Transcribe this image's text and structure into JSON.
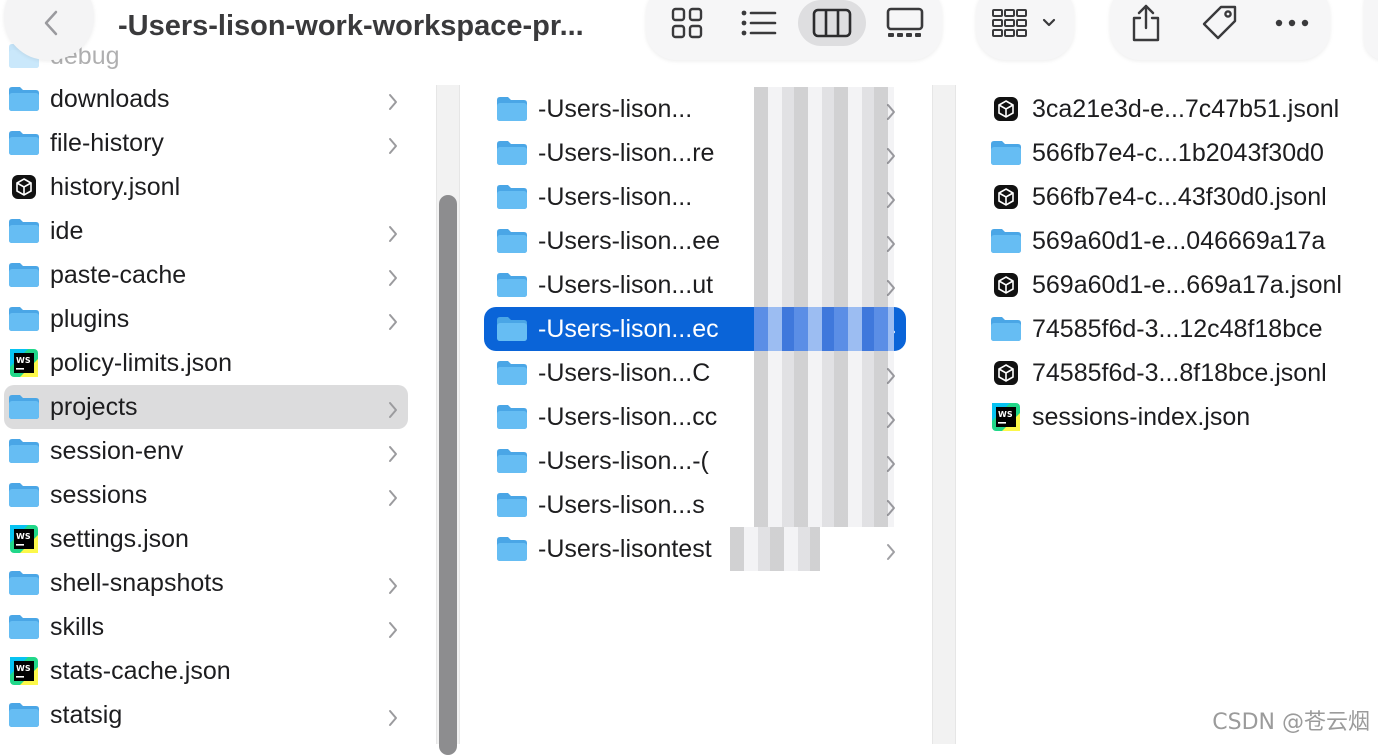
{
  "toolbar": {
    "title": "-Users-lison-work-workspace-pr...",
    "icons": [
      "back-chevron-icon",
      "grid-view-icon",
      "list-view-icon",
      "column-view-icon",
      "gallery-view-icon",
      "group-icon",
      "share-icon",
      "tag-icon",
      "more-icon"
    ]
  },
  "sidebar": {
    "partial_top": "debug",
    "items": [
      {
        "label": "downloads",
        "kind": "folder",
        "chevron": true
      },
      {
        "label": "file-history",
        "kind": "folder",
        "chevron": true
      },
      {
        "label": "history.jsonl",
        "kind": "jsonl",
        "chevron": false
      },
      {
        "label": "ide",
        "kind": "folder",
        "chevron": true
      },
      {
        "label": "paste-cache",
        "kind": "folder",
        "chevron": true
      },
      {
        "label": "plugins",
        "kind": "folder",
        "chevron": true
      },
      {
        "label": "policy-limits.json",
        "kind": "ws",
        "chevron": false
      },
      {
        "label": "projects",
        "kind": "folder",
        "chevron": true,
        "selected": true
      },
      {
        "label": "session-env",
        "kind": "folder",
        "chevron": true
      },
      {
        "label": "sessions",
        "kind": "folder",
        "chevron": true
      },
      {
        "label": "settings.json",
        "kind": "ws",
        "chevron": false
      },
      {
        "label": "shell-snapshots",
        "kind": "folder",
        "chevron": true
      },
      {
        "label": "skills",
        "kind": "folder",
        "chevron": true
      },
      {
        "label": "stats-cache.json",
        "kind": "ws",
        "chevron": false
      },
      {
        "label": "statsig",
        "kind": "folder",
        "chevron": true
      }
    ]
  },
  "projects": {
    "items": [
      {
        "label": "-Users-lison...",
        "suffix": ""
      },
      {
        "label": "-Users-lison...",
        "suffix": "re"
      },
      {
        "label": "-Users-lison...",
        "suffix": ""
      },
      {
        "label": "-Users-lison...",
        "suffix": "ee"
      },
      {
        "label": "-Users-lison...",
        "suffix": "ut"
      },
      {
        "label": "-Users-lison...",
        "suffix": "ec",
        "selected": true
      },
      {
        "label": "-Users-lison...",
        "suffix": "C"
      },
      {
        "label": "-Users-lison...",
        "suffix": "cc"
      },
      {
        "label": "-Users-lison...",
        "suffix": "-("
      },
      {
        "label": "-Users-lison...",
        "suffix": "s"
      },
      {
        "label": "-Users-lison",
        "suffix": "test"
      }
    ]
  },
  "files": {
    "items": [
      {
        "label": "3ca21e3d-e...7c47b51.jsonl",
        "kind": "jsonl"
      },
      {
        "label": "566fb7e4-c...1b2043f30d0",
        "kind": "folder"
      },
      {
        "label": "566fb7e4-c...43f30d0.jsonl",
        "kind": "jsonl"
      },
      {
        "label": "569a60d1-e...046669a17a",
        "kind": "folder"
      },
      {
        "label": "569a60d1-e...669a17a.jsonl",
        "kind": "jsonl"
      },
      {
        "label": "74585f6d-3...12c48f18bce",
        "kind": "folder"
      },
      {
        "label": "74585f6d-3...8f18bce.jsonl",
        "kind": "jsonl"
      },
      {
        "label": "sessions-index.json",
        "kind": "ws"
      }
    ]
  },
  "watermark": "CSDN @苍云烟",
  "colors": {
    "folder": "#5ab4ee",
    "selection": "#0a64d8",
    "sidebar_selection": "#dcdcdd"
  }
}
